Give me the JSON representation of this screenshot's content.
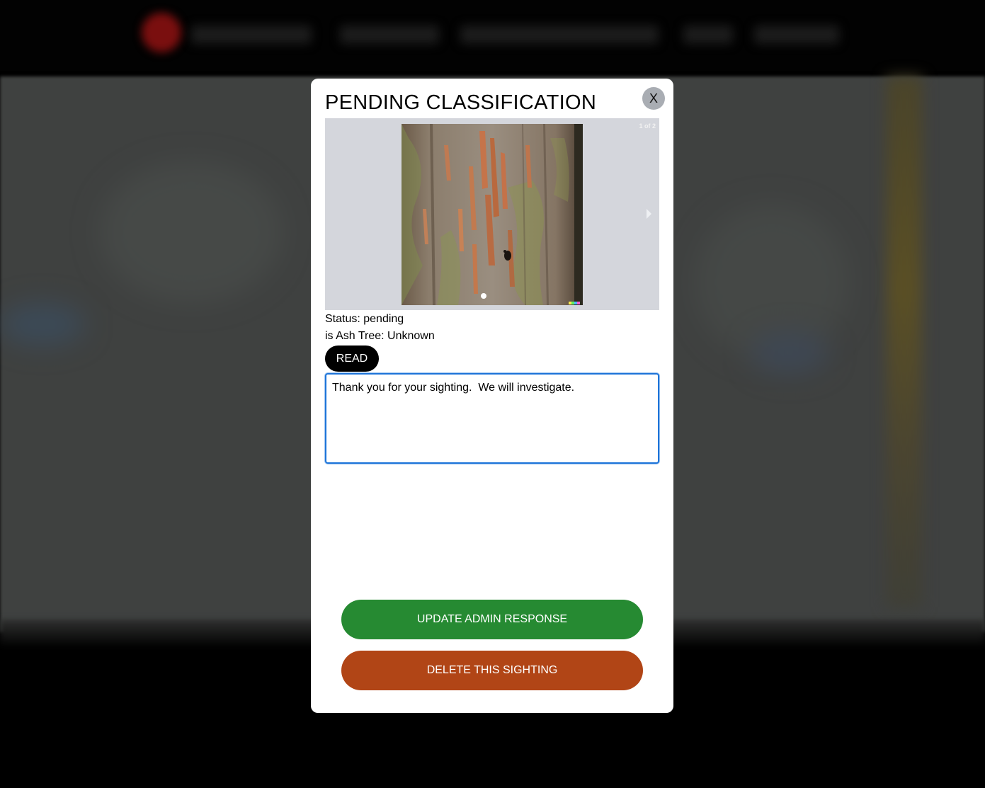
{
  "modal": {
    "title": "PENDING CLASSIFICATION",
    "close_label": "X",
    "carousel": {
      "counter": "1 of 2",
      "current_slide": 1,
      "total_slides": 2,
      "image_description_icon": "tree-bark-photo"
    },
    "status_line": "Status: pending",
    "ash_tree_line": "is Ash Tree: Unknown",
    "read_button": "READ",
    "admin_response": "Thank you for your sighting.  We will investigate.",
    "update_button": "UPDATE ADMIN RESPONSE",
    "delete_button": "DELETE THIS SIGHTING"
  },
  "colors": {
    "update_green": "#268a32",
    "delete_orange": "#b14516",
    "read_black": "#000000",
    "textarea_focus": "#1d74d9"
  }
}
